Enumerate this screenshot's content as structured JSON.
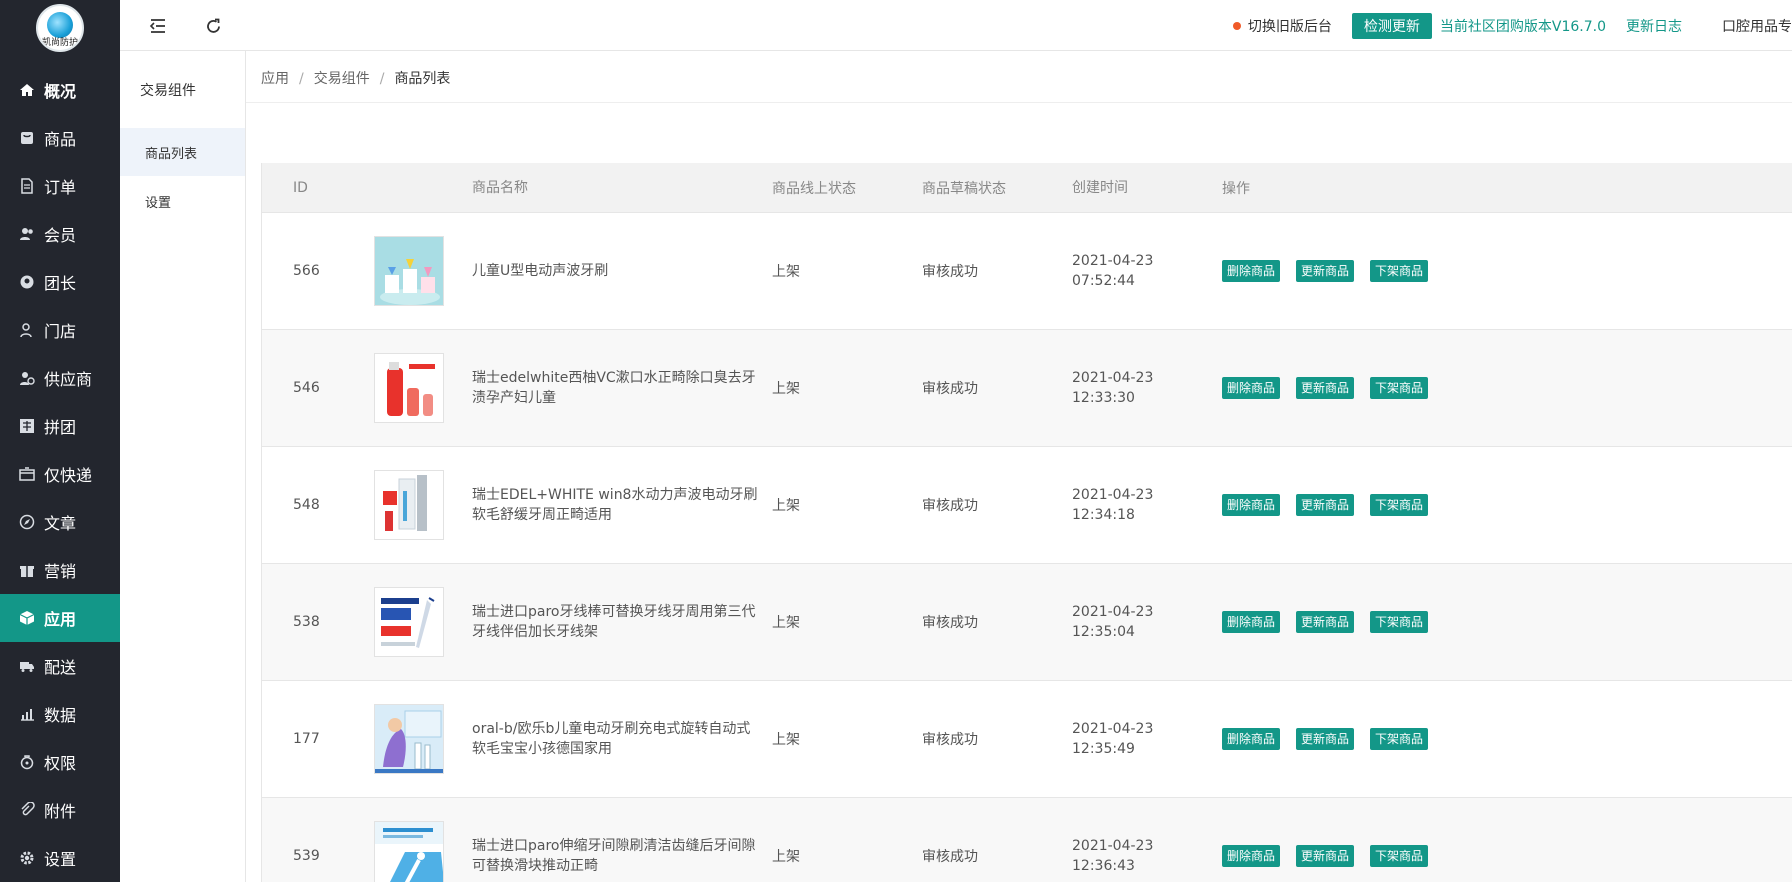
{
  "app": {
    "logo_text": "凯尚防护",
    "colors": {
      "accent": "#139788",
      "nav_bg": "#23262e",
      "dot": "#f05a28"
    }
  },
  "nav": {
    "items": [
      {
        "label": "概况",
        "icon": "home-icon"
      },
      {
        "label": "商品",
        "icon": "goods-icon"
      },
      {
        "label": "订单",
        "icon": "order-icon"
      },
      {
        "label": "会员",
        "icon": "members-icon"
      },
      {
        "label": "团长",
        "icon": "leader-icon"
      },
      {
        "label": "门店",
        "icon": "store-icon"
      },
      {
        "label": "供应商",
        "icon": "supplier-icon"
      },
      {
        "label": "拼团",
        "icon": "group-buy-icon"
      },
      {
        "label": "仅快递",
        "icon": "express-icon"
      },
      {
        "label": "文章",
        "icon": "article-icon"
      },
      {
        "label": "营销",
        "icon": "gift-icon"
      },
      {
        "label": "应用",
        "icon": "cube-icon"
      },
      {
        "label": "配送",
        "icon": "truck-icon"
      },
      {
        "label": "数据",
        "icon": "chart-icon"
      },
      {
        "label": "权限",
        "icon": "lock-icon"
      },
      {
        "label": "附件",
        "icon": "paperclip-icon"
      },
      {
        "label": "设置",
        "icon": "gear-icon"
      }
    ],
    "active_label": "应用"
  },
  "subnav": {
    "title": "交易组件",
    "items": [
      {
        "label": "商品列表"
      },
      {
        "label": "设置"
      }
    ]
  },
  "header": {
    "switch_label": "切换旧版后台",
    "check_update": "检测更新",
    "version": "当前社区团购版本V16.7.0",
    "changelog": "更新日志",
    "shop_name": "口腔用品专"
  },
  "breadcrumb": {
    "items": [
      "应用",
      "交易组件",
      "商品列表"
    ],
    "sep": "/"
  },
  "table": {
    "columns": [
      "ID",
      "",
      "商品名称",
      "商品线上状态",
      "商品草稿状态",
      "创建时间",
      "操作"
    ],
    "op_labels": {
      "delete": "删除商品",
      "update": "更新商品",
      "offline": "下架商品"
    },
    "rows": [
      {
        "id": "566",
        "name": "儿童U型电动声波牙刷",
        "online": "上架",
        "draft": "审核成功",
        "date": "2021-04-23",
        "time": "07:52:44",
        "thumb": "kids-toothbrush-thumb"
      },
      {
        "id": "546",
        "name": "瑞士edelwhite西柚VC漱口水正畸除口臭去牙渍孕产妇儿童",
        "online": "上架",
        "draft": "审核成功",
        "date": "2021-04-23",
        "time": "12:33:30",
        "thumb": "mouthwash-thumb"
      },
      {
        "id": "548",
        "name": "瑞士EDEL+WHITE win8水动力声波电动牙刷软毛舒缓牙周正畸适用",
        "online": "上架",
        "draft": "审核成功",
        "date": "2021-04-23",
        "time": "12:34:18",
        "thumb": "sonic-toothbrush-thumb"
      },
      {
        "id": "538",
        "name": "瑞士进口paro牙线棒可替换牙线牙周用第三代牙线伴侣加长牙线架",
        "online": "上架",
        "draft": "审核成功",
        "date": "2021-04-23",
        "time": "12:35:04",
        "thumb": "floss-thumb"
      },
      {
        "id": "177",
        "name": "oral-b/欧乐b儿童电动牙刷充电式旋转自动式软毛宝宝小孩德国家用",
        "online": "上架",
        "draft": "审核成功",
        "date": "2021-04-23",
        "time": "12:35:49",
        "thumb": "oralb-kids-thumb"
      },
      {
        "id": "539",
        "name": "瑞士进口paro伸缩牙间隙刷清洁齿缝后牙间隙可替换滑块推动正畸",
        "online": "上架",
        "draft": "审核成功",
        "date": "2021-04-23",
        "time": "12:36:43",
        "thumb": "interdental-brush-thumb"
      }
    ]
  }
}
